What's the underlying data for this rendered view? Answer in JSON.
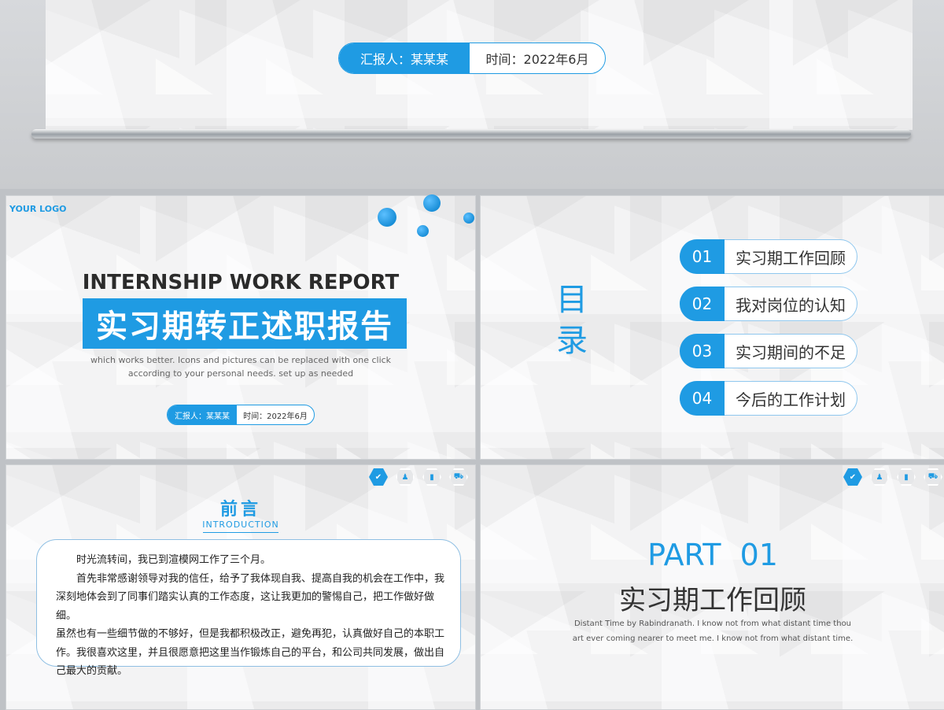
{
  "top": {
    "reporter_label": "汇报人：某某某",
    "time_label": "时间：2022年6月"
  },
  "cover": {
    "logo": "YOUR LOGO",
    "title_en": "INTERNSHIP WORK REPORT",
    "title_cn": "实习期转正述职报告",
    "subtitle_line1": "which works better. Icons and pictures can be replaced with one click",
    "subtitle_line2": "according to your personal needs. set up as needed",
    "reporter_label": "汇报人：某某某",
    "time_label": "时间：2022年6月"
  },
  "toc": {
    "heading": "目录",
    "heading_chars": [
      "目",
      "录"
    ],
    "items": [
      {
        "num": "01",
        "label": "实习期工作回顾"
      },
      {
        "num": "02",
        "label": "我对岗位的认知"
      },
      {
        "num": "03",
        "label": "实习期间的不足"
      },
      {
        "num": "04",
        "label": "今后的工作计划"
      }
    ]
  },
  "preface": {
    "title": "前言",
    "subtitle": "INTRODUCTION",
    "para1": "时光流转间，我已到渲模网工作了三个月。",
    "para2_lines": [
      "首先非常感谢领导对我的信任，给予了我体现自我、提高自我的机会在工作中，我",
      "深刻地体会到了同事们踏实认真的工作态度，这让我更加的警惕自己，把工作做好做细。",
      "虽然也有一些细节做的不够好，但是我都积极改正，避免再犯，认真做好自己的本职工",
      "作。我很喜欢这里，并且很愿意把这里当作锻炼自己的平台，和公司共同发展，做出自",
      "己最大的贡献。"
    ]
  },
  "part": {
    "label": "PART  01",
    "title": "实习期工作回顾",
    "desc_line1": "Distant Time by Rabindranath. I know not from what distant time thou",
    "desc_line2": "art ever coming nearer to meet me. I know not from what distant time."
  },
  "nav_icons": [
    "chart-icon",
    "person-icon",
    "bar-icon",
    "truck-icon"
  ],
  "colors": {
    "accent": "#1f9be3",
    "text": "#333333"
  }
}
